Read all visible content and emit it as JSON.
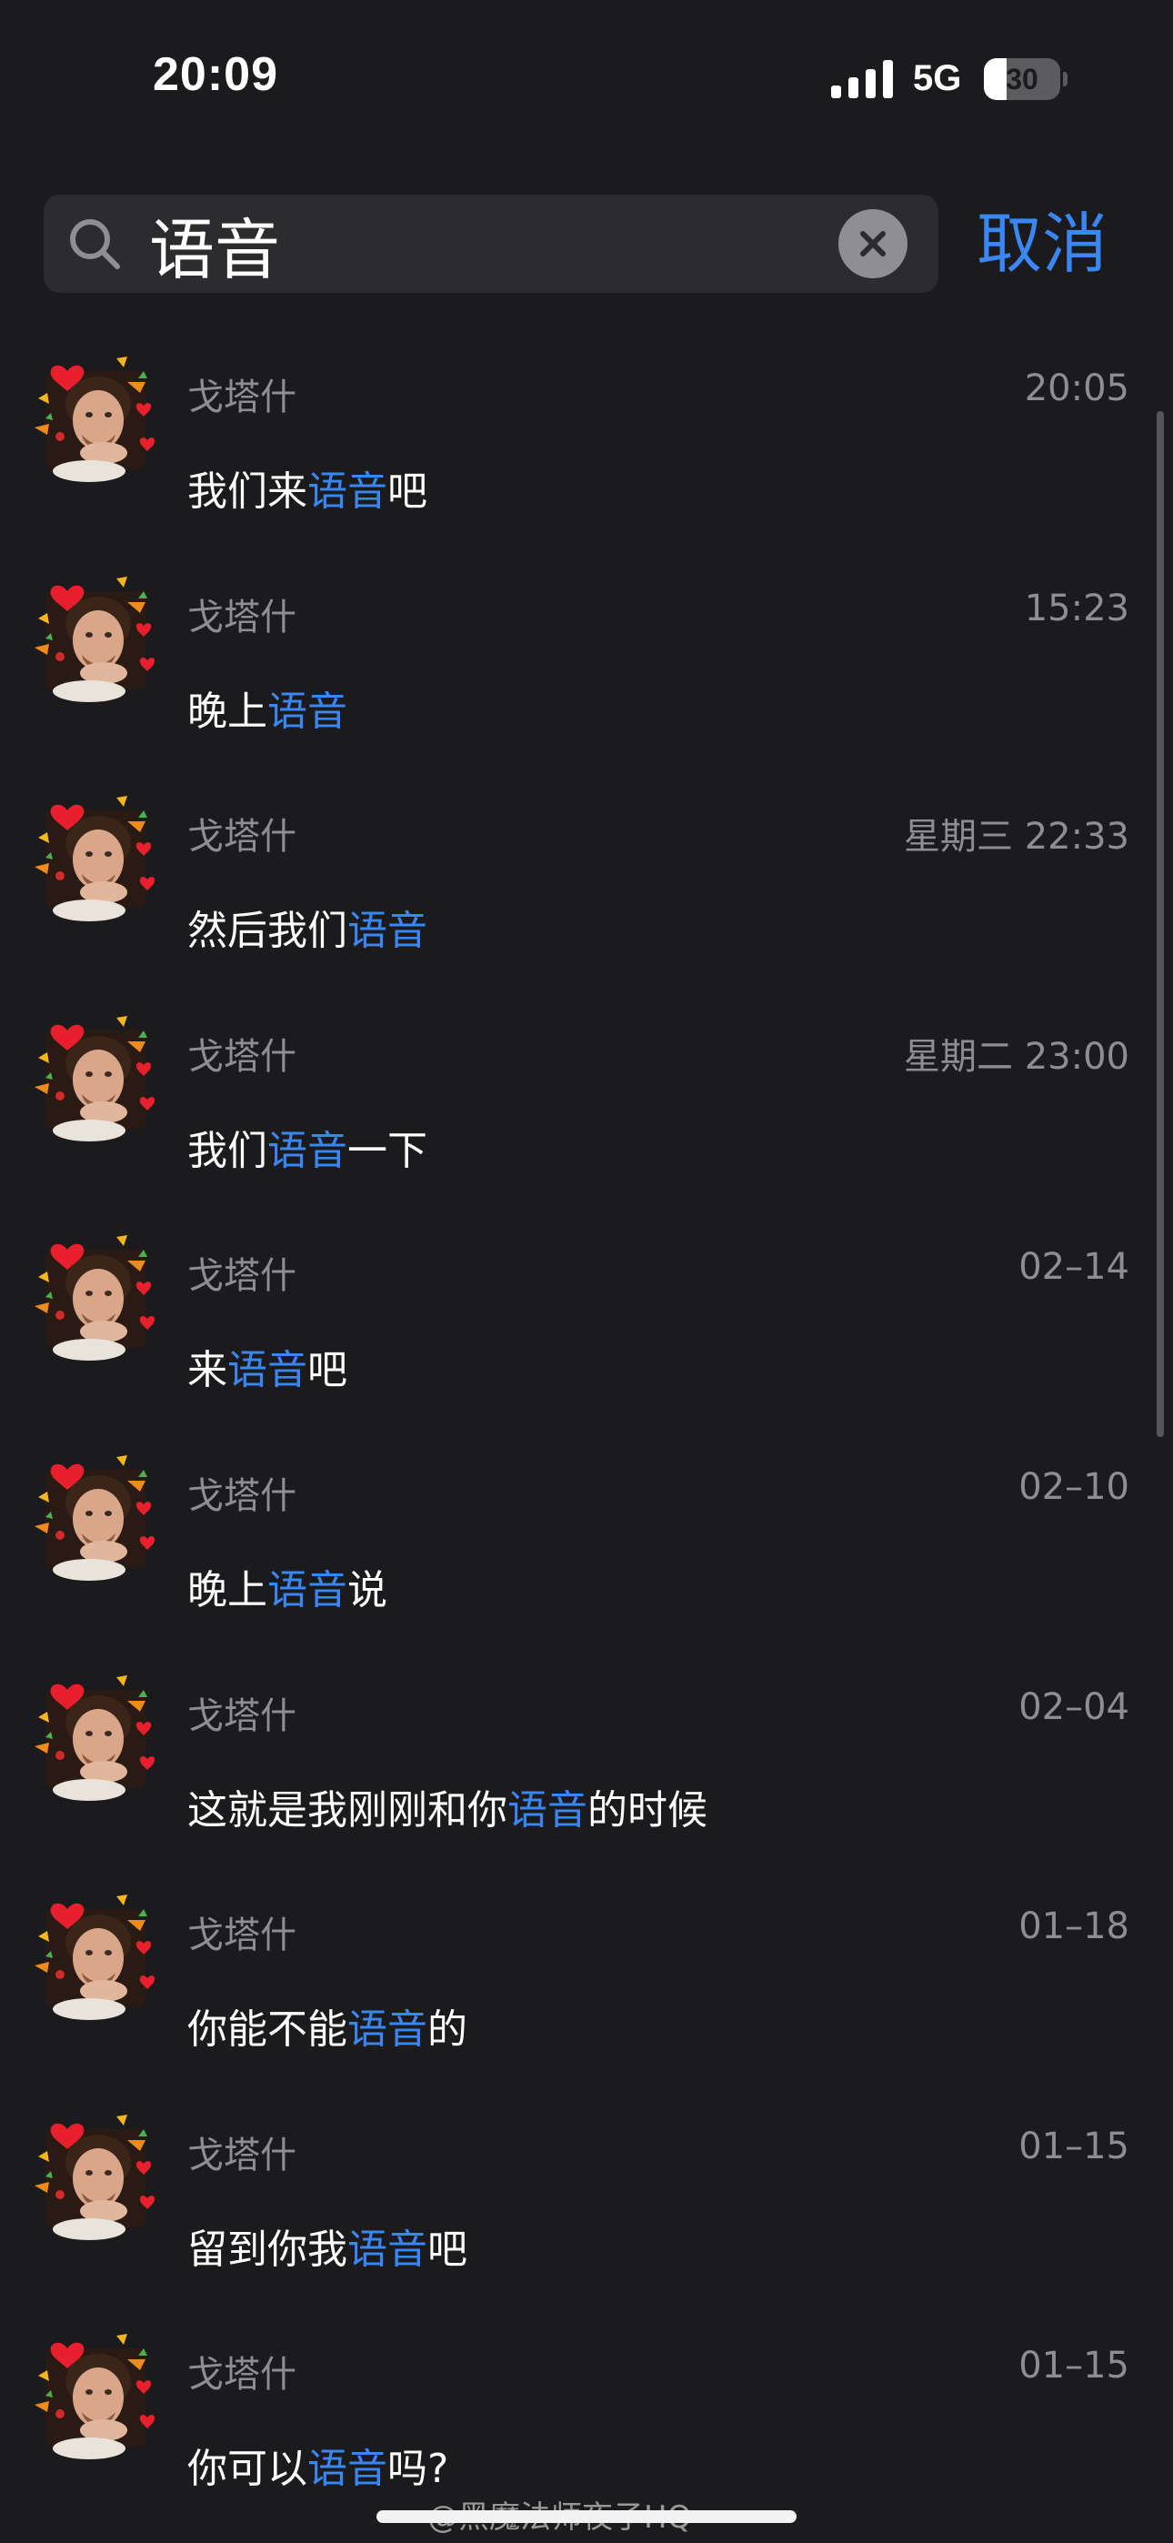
{
  "status_bar": {
    "time": "20:09",
    "network": "5G",
    "battery_level": "30",
    "battery_fraction": 0.3
  },
  "search": {
    "query": "语音",
    "cancel_label": "取消"
  },
  "colors": {
    "background": "#1b1b1d",
    "accent": "#3a86f3",
    "muted_text": "#8d8d92"
  },
  "results": [
    {
      "sender": "戈塔什",
      "time": "20:05",
      "parts": [
        {
          "t": "我们来"
        },
        {
          "t": "语音",
          "hl": true
        },
        {
          "t": "吧"
        }
      ]
    },
    {
      "sender": "戈塔什",
      "time": "15:23",
      "parts": [
        {
          "t": "晚上"
        },
        {
          "t": "语音",
          "hl": true
        }
      ]
    },
    {
      "sender": "戈塔什",
      "time": "星期三 22:33",
      "parts": [
        {
          "t": "然后我们"
        },
        {
          "t": "语音",
          "hl": true
        }
      ]
    },
    {
      "sender": "戈塔什",
      "time": "星期二 23:00",
      "parts": [
        {
          "t": "我们"
        },
        {
          "t": "语音",
          "hl": true
        },
        {
          "t": "一下"
        }
      ]
    },
    {
      "sender": "戈塔什",
      "time": "02–14",
      "parts": [
        {
          "t": "来"
        },
        {
          "t": "语音",
          "hl": true
        },
        {
          "t": "吧"
        }
      ]
    },
    {
      "sender": "戈塔什",
      "time": "02–10",
      "parts": [
        {
          "t": "晚上"
        },
        {
          "t": "语音",
          "hl": true
        },
        {
          "t": "说"
        }
      ]
    },
    {
      "sender": "戈塔什",
      "time": "02–04",
      "parts": [
        {
          "t": "这就是我刚刚和你"
        },
        {
          "t": "语音",
          "hl": true
        },
        {
          "t": "的时候"
        }
      ]
    },
    {
      "sender": "戈塔什",
      "time": "01–18",
      "parts": [
        {
          "t": "你能不能"
        },
        {
          "t": "语音",
          "hl": true
        },
        {
          "t": "的"
        }
      ]
    },
    {
      "sender": "戈塔什",
      "time": "01–15",
      "parts": [
        {
          "t": "留到你我"
        },
        {
          "t": "语音",
          "hl": true
        },
        {
          "t": "吧"
        }
      ]
    },
    {
      "sender": "戈塔什",
      "time": "01–15",
      "parts": [
        {
          "t": "你可以"
        },
        {
          "t": "语音",
          "hl": true
        },
        {
          "t": "吗?"
        }
      ]
    }
  ],
  "watermark": "@黑魔法师夜子HQ"
}
